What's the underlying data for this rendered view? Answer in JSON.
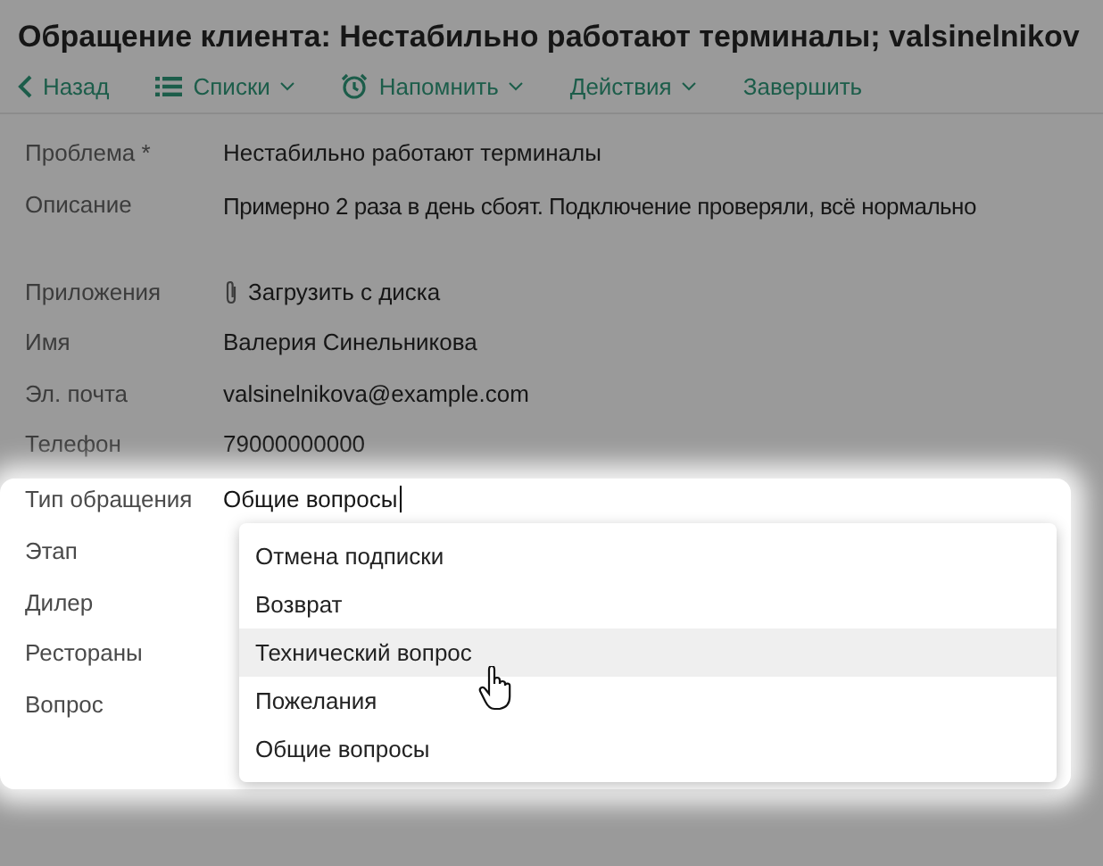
{
  "title": "Обращение клиента: Нестабильно работают терминалы; valsinelnikov",
  "toolbar": [
    {
      "kind": "back",
      "label": "Назад"
    },
    {
      "kind": "list",
      "label": "Списки",
      "dropdown": true
    },
    {
      "kind": "alarm",
      "label": "Напомнить",
      "dropdown": true
    },
    {
      "kind": "plain",
      "label": "Действия",
      "dropdown": true
    },
    {
      "kind": "plain",
      "label": "Завершить",
      "dropdown": false
    }
  ],
  "fields": [
    {
      "kind": "text",
      "label": "Проблема *",
      "value": "Нестабильно работают терминалы"
    },
    {
      "kind": "textarea",
      "label": "Описание",
      "value": "Примерно 2 раза в день сбоят. Подключение проверяли, всё нормально"
    },
    {
      "kind": "attach",
      "label": "Приложения",
      "value": "Загрузить с диска"
    },
    {
      "kind": "text",
      "label": "Имя",
      "value": "Валерия Синельникова"
    },
    {
      "kind": "text",
      "label": "Эл. почта",
      "value": "valsinelnikova@example.com"
    },
    {
      "kind": "text",
      "label": "Телефон",
      "value": "79000000000"
    }
  ],
  "focus_fields": [
    {
      "kind": "input",
      "label": "Тип обращения",
      "value": "Общие вопросы"
    },
    {
      "kind": "empty",
      "label": "Этап"
    },
    {
      "kind": "empty",
      "label": "Дилер"
    },
    {
      "kind": "empty",
      "label": "Рестораны"
    },
    {
      "kind": "empty",
      "label": "Вопрос"
    }
  ],
  "dropdown": {
    "options": [
      {
        "label": "Отмена подписки",
        "highlighted": false
      },
      {
        "label": "Возврат",
        "highlighted": false
      },
      {
        "label": "Технический вопрос",
        "highlighted": true
      },
      {
        "label": "Пожелания",
        "highlighted": false
      },
      {
        "label": "Общие вопросы",
        "highlighted": false
      }
    ]
  }
}
